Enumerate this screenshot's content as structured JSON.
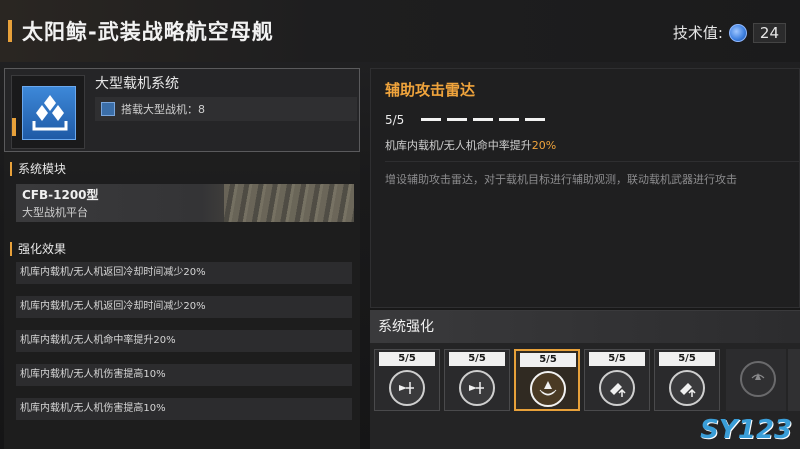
{
  "header": {
    "title": "太阳鲸-武装战略航空母舰",
    "tech_label": "技术值:",
    "tech_value": "24"
  },
  "system": {
    "name": "大型载机系统",
    "sub_label": "搭载大型战机：8"
  },
  "sections": {
    "module_head": "系统模块",
    "effects_head": "强化效果"
  },
  "module": {
    "title": "CFB-1200型",
    "subtitle": "大型战机平台"
  },
  "effects": [
    "机库内载机/无人机返回冷却时间减少20%",
    "机库内载机/无人机返回冷却时间减少20%",
    "机库内载机/无人机命中率提升20%",
    "机库内载机/无人机伤害提高10%",
    "机库内载机/无人机伤害提高10%"
  ],
  "skill": {
    "title": "辅助攻击雷达",
    "level": "5/5",
    "effect_prefix": "机库内载机/无人机命中率提升",
    "effect_value": "20%",
    "description": "增设辅助攻击雷达，对于载机目标进行辅助观测，联动载机武器进行攻击"
  },
  "enhance": {
    "head": "系统强化",
    "slots": [
      {
        "count": "5/5",
        "icon": "drone-cooldown-icon",
        "active": false
      },
      {
        "count": "5/5",
        "icon": "drone-cooldown-icon",
        "active": false
      },
      {
        "count": "5/5",
        "icon": "radar-icon",
        "active": true
      },
      {
        "count": "5/5",
        "icon": "drone-damage-up-icon",
        "active": false
      },
      {
        "count": "5/5",
        "icon": "drone-damage-up-icon",
        "active": false
      }
    ],
    "locked_icon": "radar-icon-locked"
  },
  "watermark": "SY123"
}
